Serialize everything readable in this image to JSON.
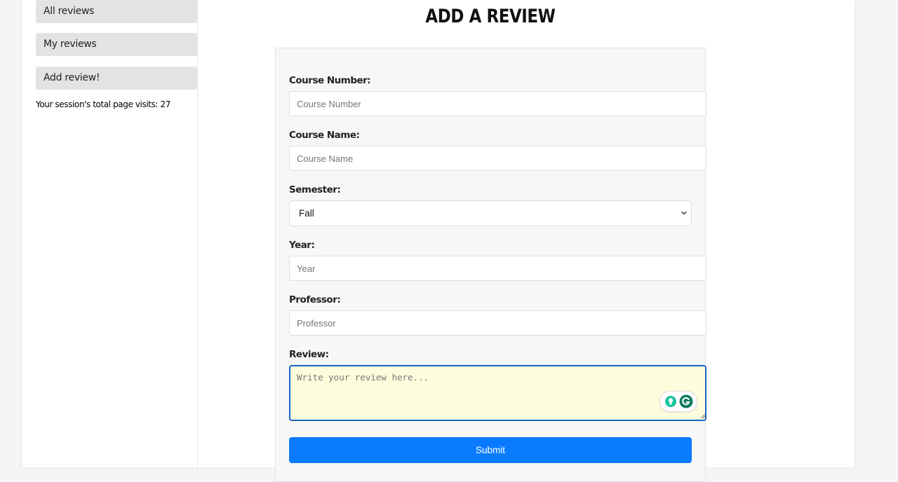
{
  "sidebar": {
    "items": [
      {
        "label": "All reviews"
      },
      {
        "label": "My reviews"
      },
      {
        "label": "Add review!"
      }
    ],
    "session_text": "Your session's total page visits: 27"
  },
  "main": {
    "title": "ADD A REVIEW",
    "form": {
      "course_number": {
        "label": "Course Number:",
        "placeholder": "Course Number",
        "value": ""
      },
      "course_name": {
        "label": "Course Name:",
        "placeholder": "Course Name",
        "value": ""
      },
      "semester": {
        "label": "Semester:",
        "selected": "Fall"
      },
      "year": {
        "label": "Year:",
        "placeholder": "Year",
        "value": ""
      },
      "professor": {
        "label": "Professor:",
        "placeholder": "Professor",
        "value": ""
      },
      "review": {
        "label": "Review:",
        "placeholder": "Write your review here...",
        "value": ""
      },
      "submit_label": "Submit"
    }
  },
  "icons": {
    "select_chevron": "chevron-down-icon",
    "grammarly_suggest": "lightbulb-icon",
    "grammarly_logo": "grammarly-icon"
  },
  "colors": {
    "submit_button": "#0a7bff",
    "textarea_focus_border": "#1a63c7",
    "textarea_background": "#fdfcdc",
    "grammarly_green": "#15c39a"
  }
}
